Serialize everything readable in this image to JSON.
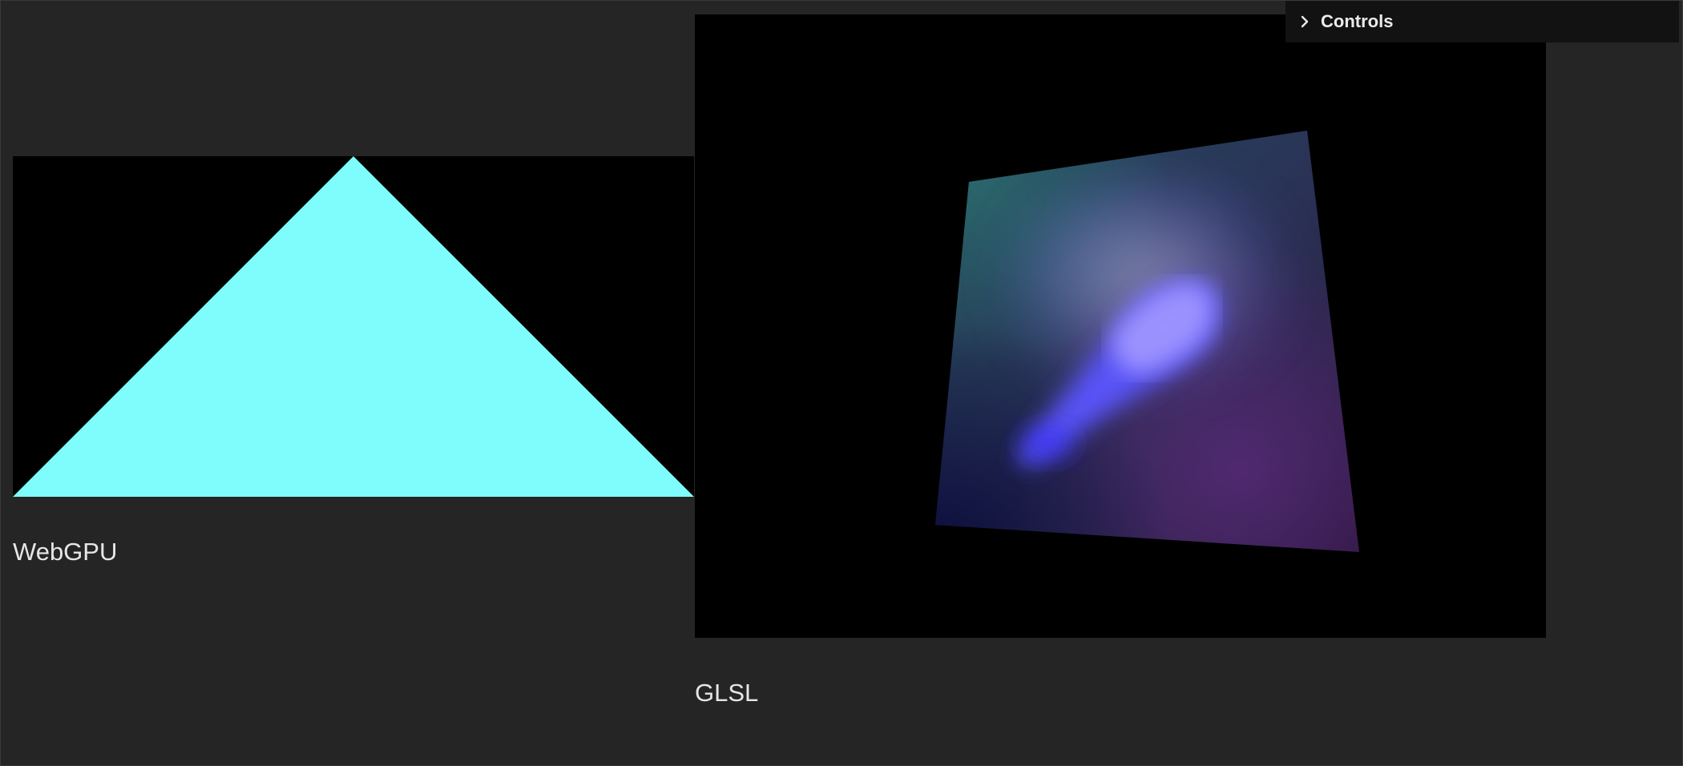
{
  "controls": {
    "label": "Controls",
    "icon": "chevron-right-icon"
  },
  "webgpu": {
    "caption": "WebGPU",
    "shape_color": "#7ffdfd",
    "background_color": "#000000"
  },
  "glsl": {
    "caption": "GLSL",
    "background_color": "#000000",
    "gradient_colors": [
      "#2a5f6a",
      "#9b8cff",
      "#3a2fff",
      "#4a1f5a",
      "#10102a"
    ]
  },
  "theme": {
    "page_background": "#252525",
    "panel_background": "#121212",
    "text_color": "#e6e6e6"
  }
}
